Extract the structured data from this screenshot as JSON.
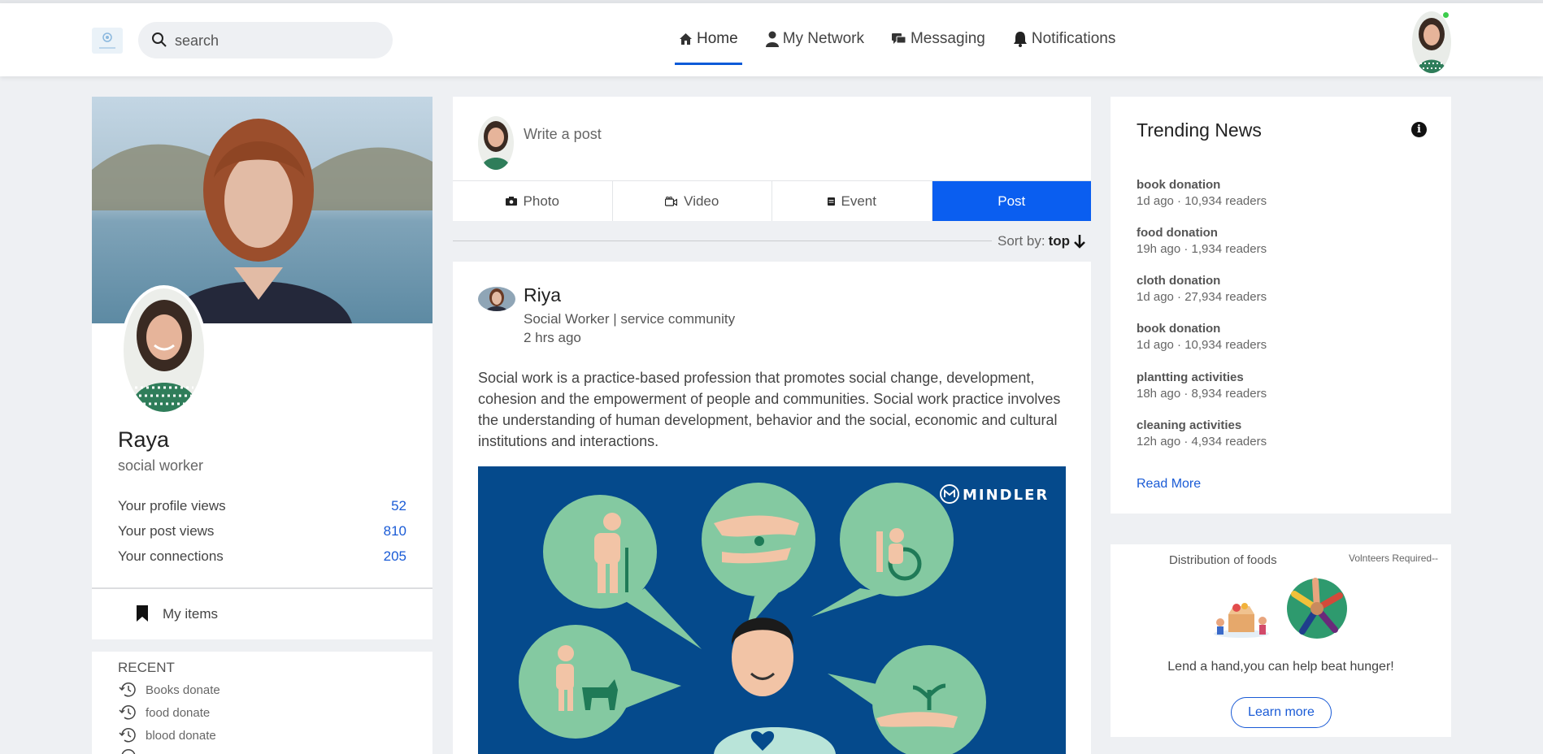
{
  "header": {
    "search_placeholder": "search",
    "nav": [
      {
        "label": "Home",
        "icon": "home-icon",
        "active": true
      },
      {
        "label": "My Network",
        "icon": "person-icon"
      },
      {
        "label": "Messaging",
        "icon": "chat-icon"
      },
      {
        "label": "Notifications",
        "icon": "bell-icon"
      }
    ],
    "online": true
  },
  "profile": {
    "name": "Raya",
    "role": "social worker",
    "stats": [
      {
        "label": "Your profile views",
        "value": "52"
      },
      {
        "label": "Your post views",
        "value": "810"
      },
      {
        "label": "Your connections",
        "value": "205"
      }
    ],
    "my_items": "My items"
  },
  "recent": {
    "title": "RECENT",
    "items": [
      "Books donate",
      "food donate",
      "blood donate"
    ]
  },
  "composer": {
    "placeholder": "Write a post",
    "tabs": [
      "Photo",
      "Video",
      "Event",
      "Post"
    ]
  },
  "sort": {
    "label": "Sort by:",
    "value": "top"
  },
  "post": {
    "author": "Riya",
    "subtitle": "Social Worker | service community",
    "time": "2 hrs ago",
    "body": "Social work is a practice-based profession that promotes social change, development, cohesion and the empowerment of people and communities. Social work practice involves the understanding of human development, behavior and the social, economic and cultural institutions and interactions.",
    "image_brand": "MINDLER"
  },
  "trending": {
    "title": "Trending News",
    "items": [
      {
        "headline": "book donation",
        "meta": "1d ago · 10,934 readers"
      },
      {
        "headline": "food donation",
        "meta": "19h ago · 1,934 readers"
      },
      {
        "headline": "cloth donation",
        "meta": "1d ago · 27,934 readers"
      },
      {
        "headline": "book donation",
        "meta": "1d ago · 10,934 readers"
      },
      {
        "headline": "plantting activities",
        "meta": "18h ago · 8,934 readers"
      },
      {
        "headline": "cleaning activities",
        "meta": "12h ago · 4,934 readers"
      }
    ],
    "read_more": "Read More"
  },
  "promo": {
    "title": "Distribution of foods",
    "side_label": "Volnteers Required--",
    "tagline": "Lend a hand,you can help beat hunger!",
    "button": "Learn more"
  },
  "colors": {
    "accent": "#0a5ef0",
    "link": "#1a5bd6",
    "background": "#eef0f3",
    "post_image_bg": "#054a8c",
    "bubble": "#84c9a1"
  }
}
